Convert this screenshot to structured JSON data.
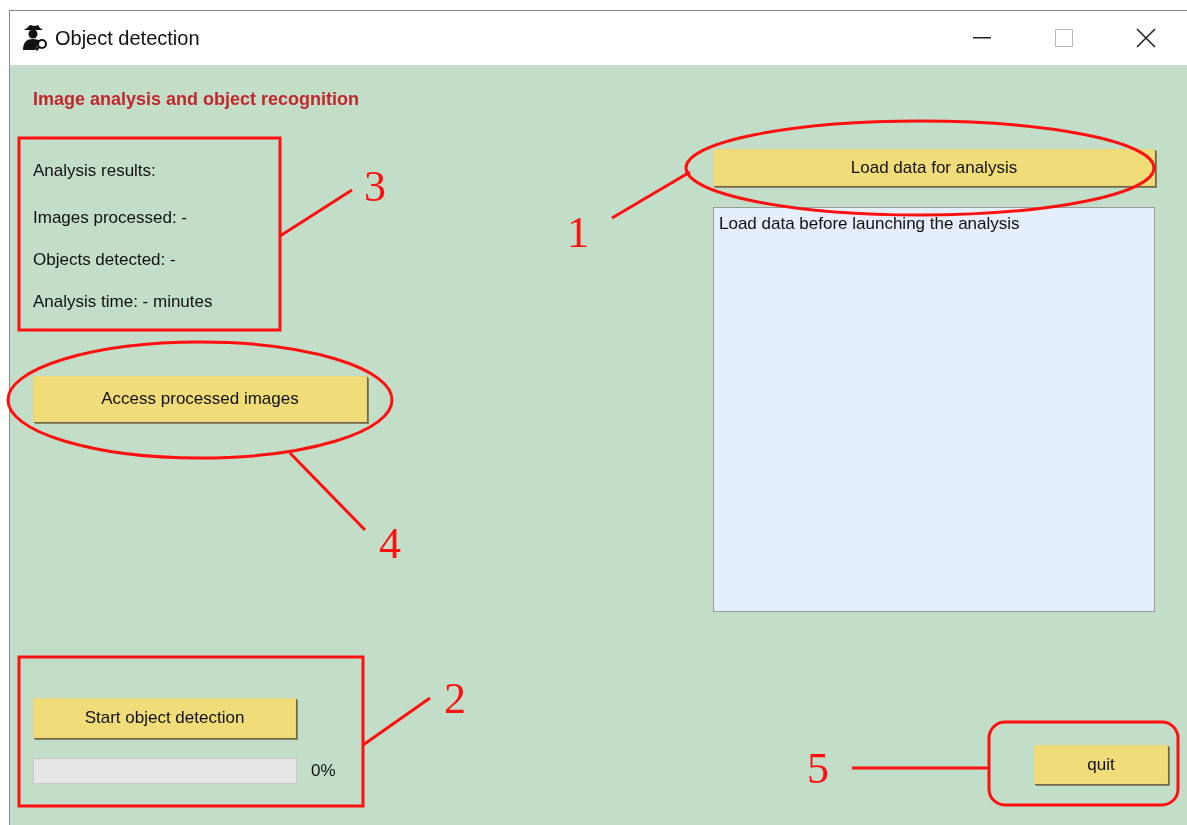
{
  "window": {
    "title": "Object detection"
  },
  "heading": "Image analysis and object recognition",
  "results": {
    "title": "Analysis results:",
    "lines": [
      "Images processed: -",
      "Objects detected: -",
      "Analysis time: - minutes"
    ]
  },
  "buttons": {
    "access": "Access processed images",
    "start": "Start object detection",
    "load": "Load data for analysis",
    "quit": "quit"
  },
  "progress": {
    "level": 0,
    "reading": "0%"
  },
  "log": {
    "message": "Load data before launching the analysis"
  },
  "annotations": [
    {
      "number": "1",
      "kind": "ellipse"
    },
    {
      "number": "2",
      "kind": "rect"
    },
    {
      "number": "3",
      "kind": "rect"
    },
    {
      "number": "4",
      "kind": "ellipse"
    },
    {
      "number": "5",
      "kind": "rounded"
    }
  ]
}
